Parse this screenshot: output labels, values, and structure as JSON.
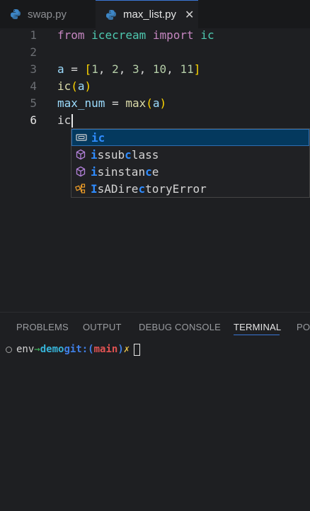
{
  "tabs": [
    {
      "label": "swap.py",
      "icon": "python-icon",
      "active": false
    },
    {
      "label": "max_list.py",
      "icon": "python-icon",
      "active": true,
      "close": "✕"
    }
  ],
  "editor": {
    "line_numbers": [
      "1",
      "2",
      "3",
      "4",
      "5",
      "6"
    ],
    "lines": {
      "l1": {
        "from": "from",
        "module": "icecream",
        "import": "import",
        "name": "ic"
      },
      "l3": {
        "var": "a",
        "eq": " = ",
        "open": "[",
        "n1": "1",
        "c1": ", ",
        "n2": "2",
        "c2": ", ",
        "n3": "3",
        "c3": ", ",
        "n4": "10",
        "c4": ", ",
        "n5": "11",
        "close": "]"
      },
      "l4": {
        "fn": "ic",
        "open": "(",
        "arg": "a",
        "close": ")"
      },
      "l5": {
        "var": "max_num",
        "eq": " = ",
        "fn": "max",
        "open": "(",
        "arg": "a",
        "close": ")"
      },
      "l6": {
        "text": "ic"
      }
    }
  },
  "suggestions": [
    {
      "icon": "variable-icon",
      "match": [
        "ic"
      ],
      "rest": [
        ""
      ],
      "label": "ic"
    },
    {
      "icon": "method-cube-icon",
      "parts": [
        "i",
        "ss",
        "ub",
        "c",
        "lass"
      ],
      "label": "issubclass"
    },
    {
      "icon": "method-cube-icon",
      "parts": [
        "i",
        "sinstan",
        "c",
        "e"
      ],
      "label": "isinstance"
    },
    {
      "icon": "class-icon",
      "parts": [
        "I",
        "sADire",
        "c",
        "toryError"
      ],
      "label": "IsADirectoryError"
    }
  ],
  "panel": {
    "tabs": [
      "PROBLEMS",
      "OUTPUT",
      "DEBUG CONSOLE",
      "TERMINAL",
      "PO"
    ],
    "active_tab": "TERMINAL",
    "terminal": {
      "env": "env",
      "arrow": "→",
      "dir": "demo",
      "git": "git:",
      "open": "(",
      "branch": "main",
      "close": ")",
      "dirty": "✗"
    }
  },
  "colors": {
    "accent": "#3a76d6",
    "highlight": "#2f8cff"
  }
}
